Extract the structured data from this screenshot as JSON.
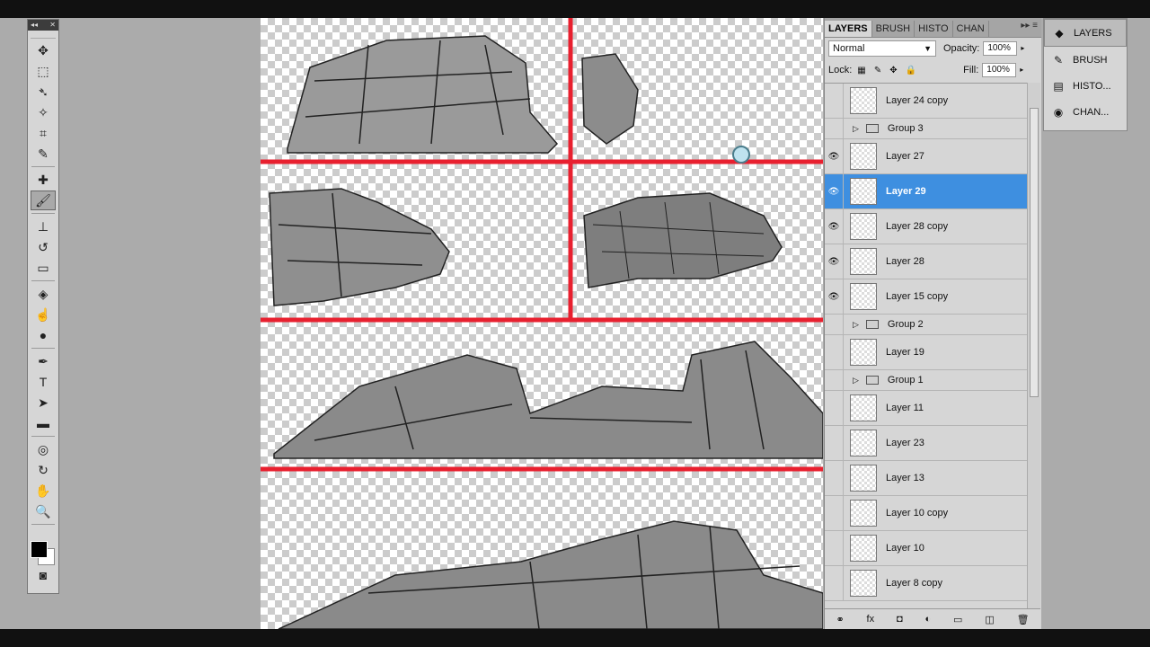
{
  "tools_panel": {
    "header_collapse": "◂◂",
    "header_close": "✕",
    "tools": [
      {
        "name": "move-tool-icon",
        "glyph": "✥"
      },
      {
        "name": "marquee-tool-icon",
        "glyph": "⬚"
      },
      {
        "name": "lasso-tool-icon",
        "glyph": "➴"
      },
      {
        "name": "quick-selection-tool-icon",
        "glyph": "✧"
      },
      {
        "name": "crop-tool-icon",
        "glyph": "⌗"
      },
      {
        "name": "eyedropper-tool-icon",
        "glyph": "✎"
      },
      {
        "name": "healing-brush-tool-icon",
        "glyph": "✚"
      },
      {
        "name": "brush-tool-icon",
        "glyph": "🖌",
        "active": true
      },
      {
        "name": "clone-stamp-tool-icon",
        "glyph": "⊥"
      },
      {
        "name": "history-brush-tool-icon",
        "glyph": "↺"
      },
      {
        "name": "eraser-tool-icon",
        "glyph": "▭"
      },
      {
        "name": "paint-bucket-tool-icon",
        "glyph": "◈"
      },
      {
        "name": "smudge-tool-icon",
        "glyph": "☝"
      },
      {
        "name": "dodge-tool-icon",
        "glyph": "●"
      },
      {
        "name": "pen-tool-icon",
        "glyph": "✒"
      },
      {
        "name": "type-tool-icon",
        "glyph": "T"
      },
      {
        "name": "path-selection-tool-icon",
        "glyph": "➤"
      },
      {
        "name": "rectangle-tool-icon",
        "glyph": "▬"
      },
      {
        "name": "3d-rotate-tool-icon",
        "glyph": "◎"
      },
      {
        "name": "3d-orbit-tool-icon",
        "glyph": "↻"
      },
      {
        "name": "hand-tool-icon",
        "glyph": "✋"
      },
      {
        "name": "zoom-tool-icon",
        "glyph": "🔍"
      }
    ],
    "quick_mask_glyph": "◙"
  },
  "layers_panel": {
    "tabs": [
      {
        "label": "LAYERS",
        "active": true
      },
      {
        "label": "BRUSH"
      },
      {
        "label": "HISTO"
      },
      {
        "label": "CHAN"
      }
    ],
    "tab_menu_glyph": "▸▸ ≡",
    "blend_mode": "Normal",
    "opacity_label": "Opacity:",
    "opacity_value": "100%",
    "lock_label": "Lock:",
    "fill_label": "Fill:",
    "fill_value": "100%",
    "layers": [
      {
        "name": "Layer 24 copy",
        "visible": false
      },
      {
        "name": "Group 3",
        "group": true,
        "visible": false
      },
      {
        "name": "Layer 27",
        "visible": true
      },
      {
        "name": "Layer 29",
        "visible": true,
        "selected": true
      },
      {
        "name": "Layer 28 copy",
        "visible": true
      },
      {
        "name": "Layer 28",
        "visible": true
      },
      {
        "name": "Layer 15 copy",
        "visible": true
      },
      {
        "name": "Group 2",
        "group": true,
        "visible": false
      },
      {
        "name": "Layer 19",
        "visible": false
      },
      {
        "name": "Group 1",
        "group": true,
        "visible": false
      },
      {
        "name": "Layer 11",
        "visible": false
      },
      {
        "name": "Layer 23",
        "visible": false
      },
      {
        "name": "Layer 13",
        "visible": false
      },
      {
        "name": "Layer 10 copy",
        "visible": false
      },
      {
        "name": "Layer 10",
        "visible": false
      },
      {
        "name": "Layer 8 copy",
        "visible": false
      }
    ],
    "footer_icons": [
      "link-layers-icon",
      "fx-icon",
      "add-mask-icon",
      "adjustment-layer-icon",
      "new-group-icon",
      "new-layer-icon",
      "trash-icon"
    ],
    "footer_glyphs": [
      "⚭",
      "fx",
      "◘",
      "◐",
      "▭",
      "◫",
      "🗑"
    ]
  },
  "dock": {
    "items": [
      {
        "label": "LAYERS",
        "icon": "◆",
        "active": true
      },
      {
        "label": "BRUSH",
        "icon": "✎"
      },
      {
        "label": "HISTO...",
        "icon": "▤"
      },
      {
        "label": "CHAN...",
        "icon": "◉"
      }
    ]
  },
  "colors": {
    "guide_red": "#e8202f",
    "selection_blue": "#3e8fe0",
    "rock_gray": "#8a8a8a"
  }
}
